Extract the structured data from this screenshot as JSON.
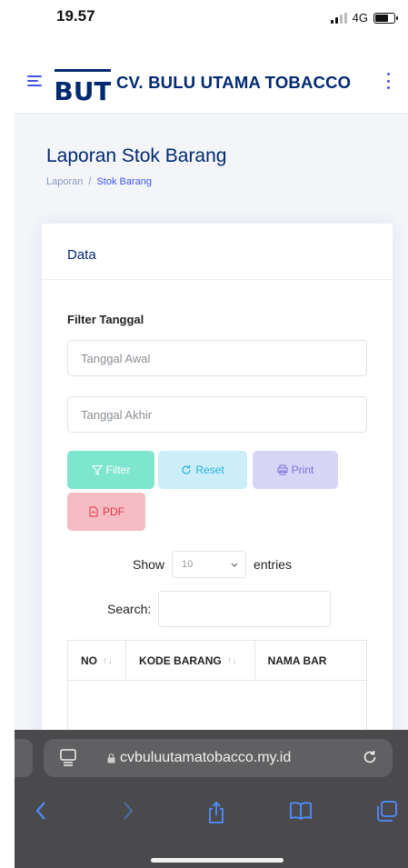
{
  "status_bar": {
    "time": "19.57",
    "network": "4G"
  },
  "header": {
    "logo_text": "BUT",
    "brand": "CV. BULU UTAMA TOBACCO"
  },
  "page": {
    "title": "Laporan Stok Barang",
    "breadcrumb": {
      "root": "Laporan",
      "separator": "/",
      "current": "Stok Barang"
    }
  },
  "card": {
    "title": "Data",
    "filter_label": "Filter Tanggal",
    "start_date_placeholder": "Tanggal Awal",
    "end_date_placeholder": "Tanggal Akhir",
    "buttons": {
      "filter": "Filter",
      "reset": "Reset",
      "print": "Print",
      "pdf": "PDF"
    },
    "entries": {
      "show_label": "Show",
      "value": "10",
      "suffix": "entries"
    },
    "search_label": "Search:",
    "table_headers": [
      "NO",
      "KODE BARANG",
      "NAMA BAR"
    ]
  },
  "browser": {
    "url": "cvbuluutamatobacco.my.id"
  },
  "colors": {
    "primary": "#4154f1",
    "brand_navy": "#012970",
    "filter_btn": "#7ee6cf",
    "reset_btn": "#cbeef9",
    "print_btn": "#d8d6f7",
    "pdf_btn": "#f6bcc4"
  },
  "icons": {
    "menu": "menu-icon",
    "more": "kebab-icon",
    "filter": "filter-icon",
    "reset": "reset-icon",
    "print": "printer-icon",
    "pdf": "pdf-icon",
    "lock": "lock-icon",
    "reload": "reload-icon"
  }
}
